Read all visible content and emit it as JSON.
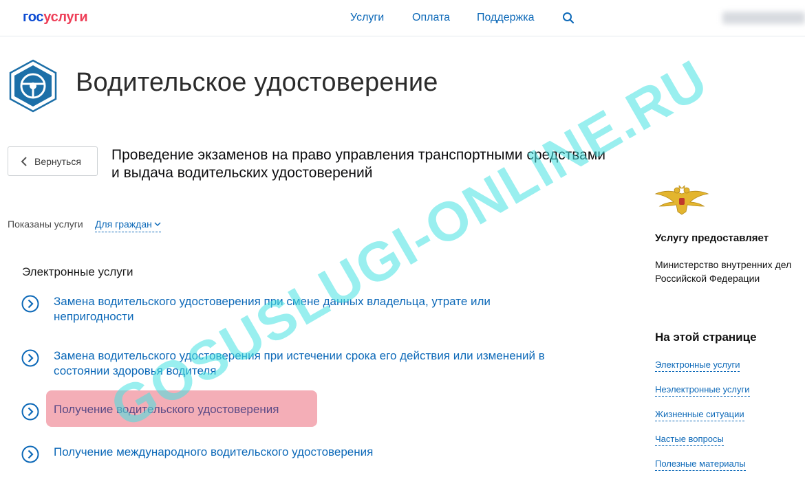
{
  "header": {
    "logo_part1": "гос",
    "logo_part2": "услуги",
    "nav": [
      {
        "label": "Услуги"
      },
      {
        "label": "Оплата"
      },
      {
        "label": "Поддержка"
      }
    ],
    "search_icon": "search-icon"
  },
  "page": {
    "title": "Водительское удостоверение",
    "emblem_icon": "steering-wheel-icon"
  },
  "back_button": {
    "label": "Вернуться",
    "icon": "chevron-left-icon"
  },
  "service_title": "Проведение экзаменов на право управления транспортными средствами и выдача водительских удостоверений",
  "filter": {
    "prefix": "Показаны услуги",
    "value": "Для граждан"
  },
  "electronic": {
    "heading": "Электронные услуги",
    "items": [
      {
        "label": "Замена водительского удостоверения при смене данных владельца, утрате или непригодности"
      },
      {
        "label": "Замена водительского удостоверения при истечении срока его действия или изменений в состоянии здоровья водителя"
      },
      {
        "label": "Получение водительского удостоверения",
        "highlighted": true
      },
      {
        "label": "Получение международного водительского удостоверения"
      }
    ]
  },
  "provider": {
    "heading": "Услугу предоставляет",
    "name": "Министерство внутренних дел Российской Федерации",
    "emblem_icon": "double-headed-eagle-emblem"
  },
  "on_page": {
    "heading": "На этой странице",
    "links": [
      {
        "label": "Электронные услуги"
      },
      {
        "label": "Неэлектронные услуги"
      },
      {
        "label": "Жизненные ситуации"
      },
      {
        "label": "Частые вопросы"
      },
      {
        "label": "Полезные материалы"
      }
    ]
  },
  "watermark": "GOSUSLUGI-ONLINE.RU",
  "colors": {
    "link": "#0d69b8",
    "logo_blue": "#0d4cd3",
    "logo_red": "#ee3f58",
    "highlight": "#f2a3ad",
    "watermark": "#46e1e1"
  }
}
